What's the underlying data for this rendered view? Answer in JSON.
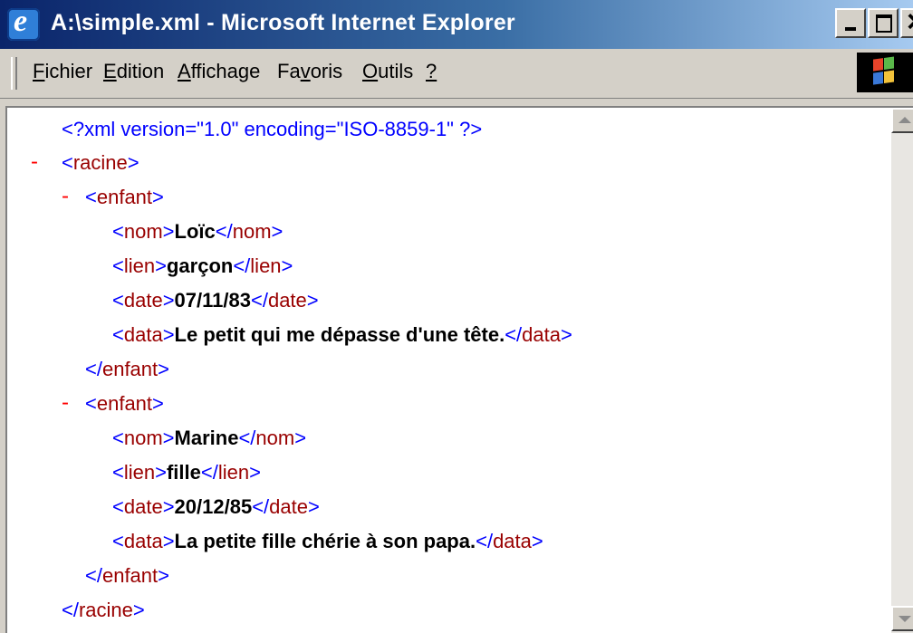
{
  "window": {
    "title": "A:\\simple.xml - Microsoft Internet Explorer"
  },
  "menu": {
    "items": [
      {
        "underline": "F",
        "rest": "ichier"
      },
      {
        "underline": "E",
        "rest": "dition"
      },
      {
        "underline": "A",
        "rest": "ffichage"
      },
      {
        "pre": "Fa",
        "underline": "v",
        "rest": "oris"
      },
      {
        "underline": "O",
        "rest": "utils"
      },
      {
        "underline": "?",
        "rest": ""
      }
    ]
  },
  "xml": {
    "declaration": "<?xml version=\"1.0\" encoding=\"ISO-8859-1\" ?>",
    "collapse_symbol": "-",
    "lt": "<",
    "gt": ">",
    "close_lt": "</",
    "root_tag": "racine",
    "child_tag": "enfant",
    "children": [
      {
        "fields": [
          {
            "tag": "nom",
            "value": "Loïc"
          },
          {
            "tag": "lien",
            "value": "garçon"
          },
          {
            "tag": "date",
            "value": "07/11/83"
          },
          {
            "tag": "data",
            "value": "Le petit qui me dépasse d'une tête."
          }
        ]
      },
      {
        "fields": [
          {
            "tag": "nom",
            "value": "Marine"
          },
          {
            "tag": "lien",
            "value": "fille"
          },
          {
            "tag": "date",
            "value": "20/12/85"
          },
          {
            "tag": "data",
            "value": "La petite fille chérie à son papa."
          }
        ]
      }
    ]
  },
  "colors": {
    "markup": "#0000ff",
    "tag_name": "#990000",
    "value": "#000000",
    "collapse": "#ff0000"
  }
}
